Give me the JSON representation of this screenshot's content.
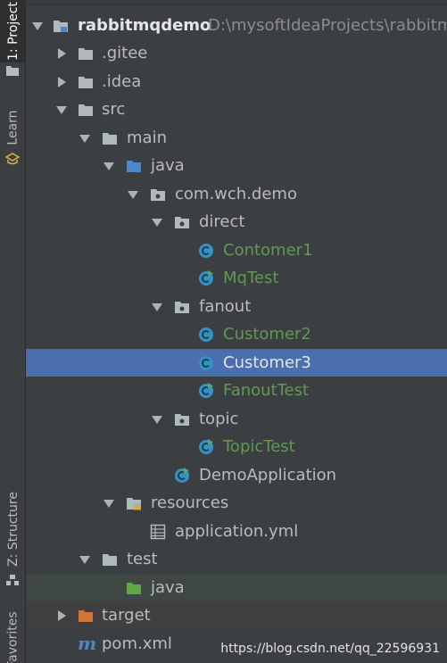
{
  "sidebar": {
    "project_tab": "1: Project",
    "learn_tab": "Learn",
    "structure_tab": "Z: Structure",
    "favorites_tab": "Favorites"
  },
  "tree": {
    "root": {
      "name": "rabbitmqdemo",
      "path": "D:\\mysoftIdeaProjects\\rabbitmqdemo"
    },
    "items": [
      {
        "label": ".gitee"
      },
      {
        "label": ".idea"
      },
      {
        "label": "src"
      },
      {
        "label": "main"
      },
      {
        "label": "java"
      },
      {
        "label": "com.wch.demo"
      },
      {
        "label": "direct"
      },
      {
        "label": "Contomer1"
      },
      {
        "label": "MqTest"
      },
      {
        "label": "fanout"
      },
      {
        "label": "Customer2"
      },
      {
        "label": "Customer3"
      },
      {
        "label": "FanoutTest"
      },
      {
        "label": "topic"
      },
      {
        "label": "TopicTest"
      },
      {
        "label": "DemoApplication"
      },
      {
        "label": "resources"
      },
      {
        "label": "application.yml"
      },
      {
        "label": "test"
      },
      {
        "label": "java"
      },
      {
        "label": "target"
      },
      {
        "label": "pom.xml"
      }
    ],
    "selected": "Customer3"
  },
  "watermark": "https://blog.csdn.net/qq_22596931",
  "colors": {
    "background": "#3c3f41",
    "selection": "#4b6eaf",
    "vcs_added_green": "#629755",
    "folder_gray": "#aeb9c0",
    "source_folder_blue": "#4a88c7",
    "test_folder_green": "#60a843",
    "excluded_folder_orange": "#d07534",
    "class_icon_cyan": "#3592c4"
  }
}
